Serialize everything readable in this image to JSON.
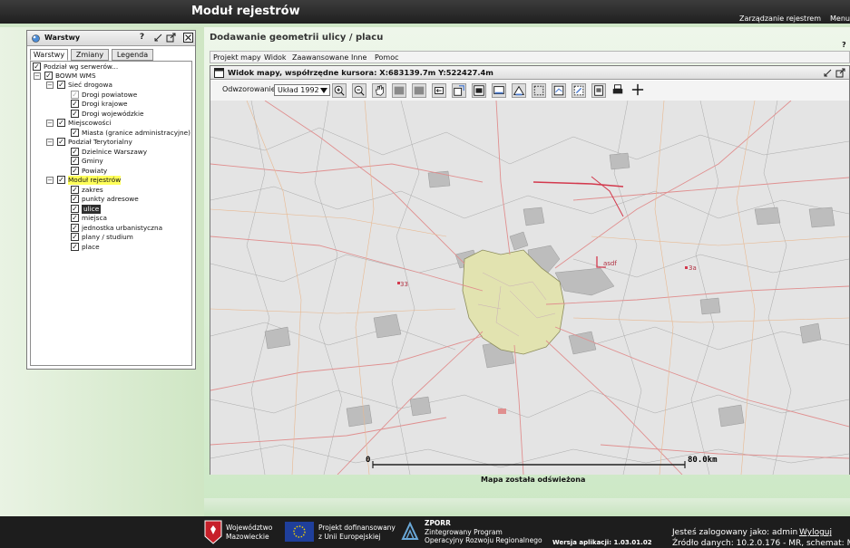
{
  "app": {
    "title": "Moduł rejestrów",
    "top_menu": [
      "Zarządzanie rejestrem",
      "Menu"
    ]
  },
  "layers_panel": {
    "title": "Warstwy",
    "help_label": "?",
    "tabs": [
      "Warstwy",
      "Zmiany",
      "Legenda"
    ],
    "tree": {
      "root": "Podział wg serwerów...",
      "groups": [
        {
          "label": "BOWM WMS",
          "children": [
            {
              "label": "Sieć drogowa",
              "children": [
                "Drogi powiatowe",
                "Drogi krajowe",
                "Drogi wojewódzkie"
              ]
            },
            {
              "label": "Miejscowości",
              "children": [
                "Miasta (granice administracyjne)"
              ]
            },
            {
              "label": "Podział Terytorialny",
              "children": [
                "Dzielnice Warszawy",
                "Gminy",
                "Powiaty"
              ]
            }
          ]
        },
        {
          "label": "Moduł rejestrów",
          "children": [
            "zakres",
            "punkty adresowe",
            "ulice",
            "miejsca",
            "jednostka urbanistyczna",
            "plany / studium",
            "place"
          ]
        }
      ]
    }
  },
  "main": {
    "section_title": "Dodawanie geometrii ulicy / placu",
    "help_label": "?",
    "menu": [
      "Projekt mapy",
      "Widok",
      "Zaawansowane",
      "Inne",
      "Pomoc"
    ],
    "map_window_title": "Widok mapy, współrzędne kursora: X:683139.7m Y:522427.4m",
    "projection_label": "Odwzorowanie:",
    "projection_value": "Układ 1992",
    "scale_start": "0",
    "scale_end": "80.0km",
    "map_labels": [
      "33",
      "asdf",
      "3a"
    ],
    "status": "Mapa została odświeżona",
    "toolbar_icons": [
      "zoom-in-icon",
      "zoom-out-icon",
      "pan-icon",
      "extent-icon",
      "previous-extent-icon",
      "next-extent-icon",
      "refresh-icon",
      "info-icon",
      "measure-icon",
      "area-icon",
      "select-icon",
      "select-box-icon",
      "edit-icon",
      "export-icon",
      "print-icon",
      "crosshair-icon"
    ]
  },
  "footer": {
    "voivodeship": [
      "Województwo",
      "Mazowieckie"
    ],
    "eu": [
      "Projekt dofinansowany",
      "z Unii Europejskiej"
    ],
    "zporr": [
      "ZPORR",
      "Zintegrowany Program",
      "Operacyjny Rozwoju Regionalnego"
    ],
    "version": "Wersja aplikacji: 1.03.01.02",
    "logged_in": "Jesteś zalogowany jako: admin",
    "logout": "Wyloguj",
    "data_source": "Źródło danych: 10.2.0.176 - MR, schemat: MR"
  },
  "colors": {
    "topbar": "#2a2a2a",
    "highlight": "#ffff5a",
    "city_fill": "#e2e3b0"
  }
}
